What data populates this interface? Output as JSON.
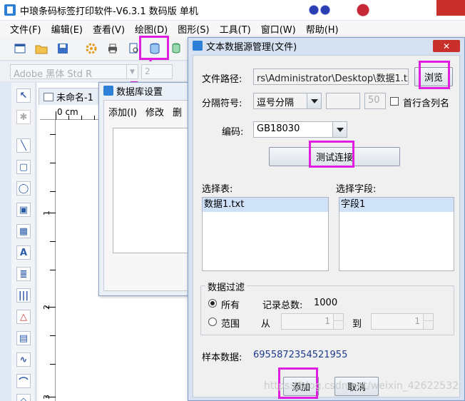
{
  "app": {
    "title": "中琅条码标签打印软件-V6.3.1 数码版 单机",
    "menu": [
      "文件(F)",
      "编辑(E)",
      "查看(V)",
      "绘图(D)",
      "图形(S)",
      "工具(T)",
      "窗口(W)",
      "帮助(H)"
    ]
  },
  "fontbar": {
    "font": "Adobe 黑体 Std R",
    "size": "2"
  },
  "document": {
    "tab": "未命名-1",
    "ruler_unit": "0 cm",
    "ruler_left_marks": [
      "1",
      "2",
      "3"
    ]
  },
  "db_dialog": {
    "title": "数据库设置",
    "menu": [
      "添加(I)",
      "修改",
      "删"
    ]
  },
  "ds_dialog": {
    "title": "文本数据源管理(文件)",
    "close": "✕",
    "file_path_label": "文件路径:",
    "file_path_value": "rs\\Administrator\\Desktop\\数据1.txt",
    "browse_label": "浏览",
    "separator_label": "分隔符号:",
    "separator_value": "逗号分隔",
    "separator_custom": "",
    "separator_width": "50",
    "first_row_label": "首行含列名",
    "encoding_label": "编码:",
    "encoding_value": "GB18030",
    "test_label": "测试连接",
    "table_label": "选择表:",
    "tables": [
      "数据1.txt"
    ],
    "field_label": "选择字段:",
    "fields": [
      "字段1"
    ],
    "filter_title": "数据过滤",
    "all_label": "所有",
    "total_label": "记录总数:",
    "total_value": "1000",
    "range_label": "范围",
    "from_label": "从",
    "from_value": "1",
    "to_label": "到",
    "to_value": "1",
    "sample_label": "样本数据:",
    "sample_value": "6955872354521955",
    "add_label": "添加",
    "cancel_label": "取消"
  },
  "watermark": "https://blog.csdn.net/weixin_42622532",
  "colors": {
    "highlight": "#e01ee0",
    "title_blue": "#2b7fd6"
  }
}
